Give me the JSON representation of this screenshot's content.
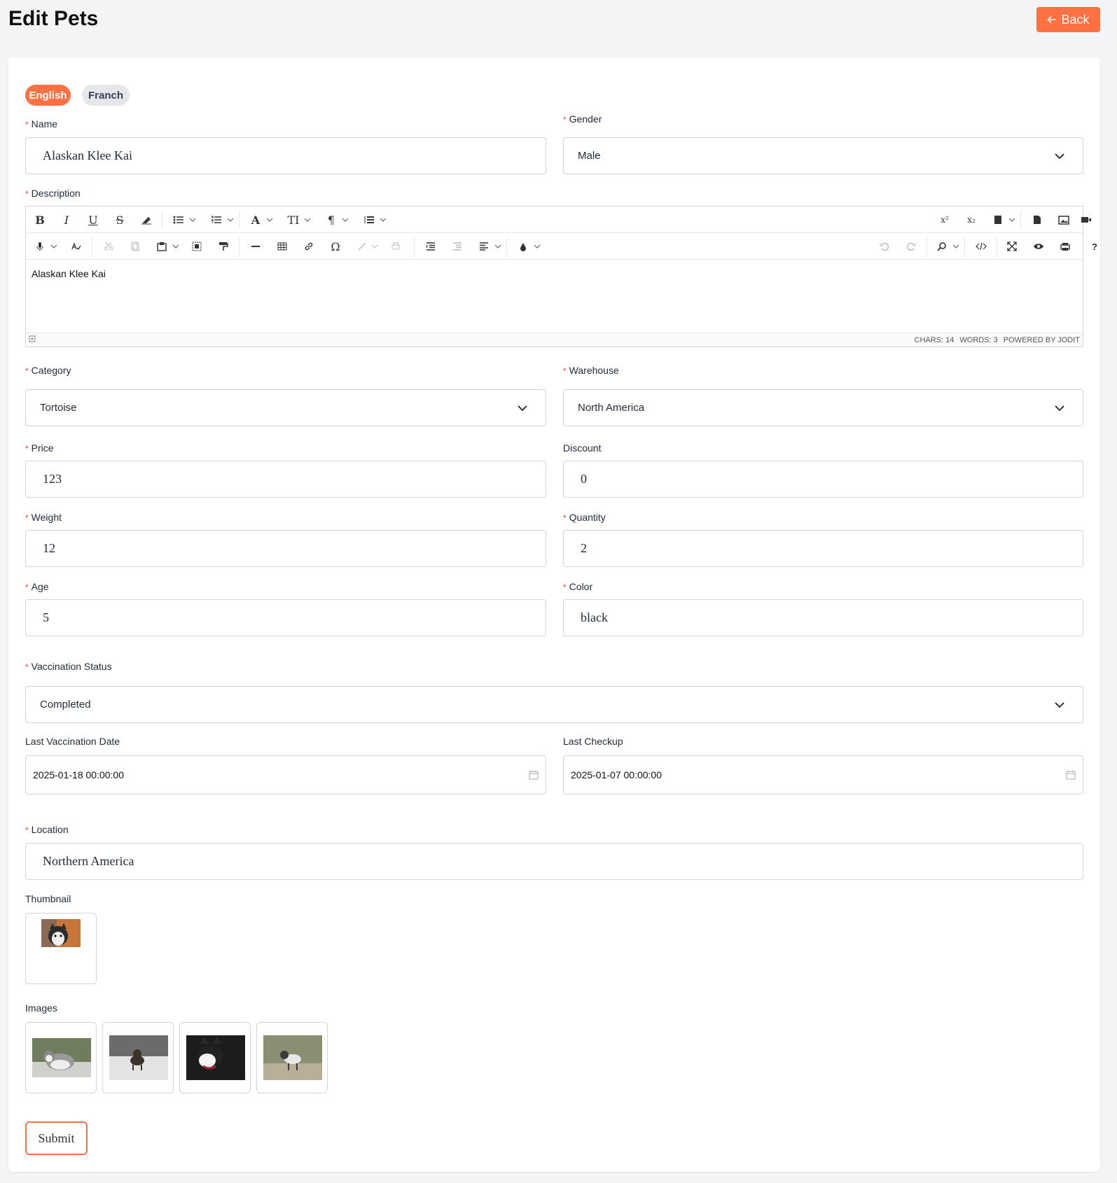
{
  "header": {
    "title": "Edit Pets",
    "back_label": "Back"
  },
  "lang_tabs": [
    "English",
    "Franch"
  ],
  "fields": {
    "name": {
      "label": "Name",
      "value": "Alaskan Klee Kai"
    },
    "gender": {
      "label": "Gender",
      "value": "Male"
    },
    "description": {
      "label": "Description",
      "value": "Alaskan Klee Kai"
    },
    "category": {
      "label": "Category",
      "value": "Tortoise"
    },
    "warehouse": {
      "label": "Warehouse",
      "value": "North America"
    },
    "price": {
      "label": "Price",
      "value": "123"
    },
    "discount": {
      "label": "Discount",
      "value": "0"
    },
    "weight": {
      "label": "Weight",
      "value": "12"
    },
    "quantity": {
      "label": "Quantity",
      "value": "2"
    },
    "age": {
      "label": "Age",
      "value": "5"
    },
    "color": {
      "label": "Color",
      "value": "black"
    },
    "vaccination_status": {
      "label": "Vaccination Status",
      "value": "Completed"
    },
    "last_vaccination_date": {
      "label": "Last Vaccination Date",
      "value": "2025-01-18 00:00:00"
    },
    "last_checkup": {
      "label": "Last Checkup",
      "value": "2025-01-07 00:00:00"
    },
    "location": {
      "label": "Location",
      "value": "Northern America"
    },
    "thumbnail": {
      "label": "Thumbnail"
    },
    "images": {
      "label": "Images"
    }
  },
  "editor": {
    "status": {
      "chars": "CHARS: 14",
      "words": "WORDS: 3",
      "powered": "POWERED BY JODIT"
    }
  },
  "submit_label": "Submit",
  "colors": {
    "accent": "#ff7043",
    "required": "#ef4444",
    "border": "#d1d5db"
  }
}
